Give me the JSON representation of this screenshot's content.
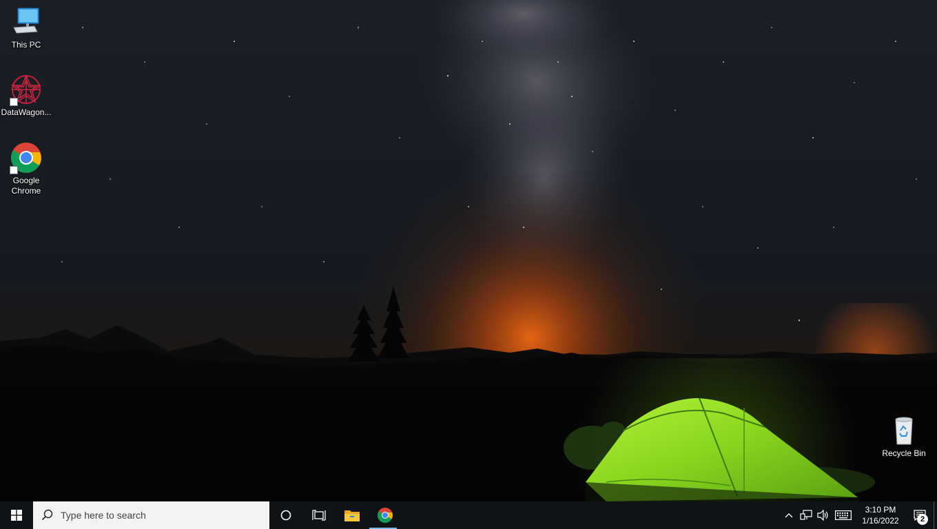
{
  "desktop": {
    "icons": [
      {
        "label": "This PC",
        "icon": "computer-icon"
      },
      {
        "label": "DataWagon...",
        "icon": "datawagon-icon"
      },
      {
        "label": "Google Chrome",
        "icon": "chrome-icon"
      },
      {
        "label": "Recycle Bin",
        "icon": "recycle-bin-icon"
      }
    ]
  },
  "taskbar": {
    "search_placeholder": "Type here to search",
    "apps": [
      {
        "name": "cortana",
        "icon": "cortana-circle-icon"
      },
      {
        "name": "task-view",
        "icon": "task-view-icon"
      },
      {
        "name": "file-explorer",
        "icon": "folder-icon"
      },
      {
        "name": "chrome",
        "icon": "chrome-icon",
        "active": true
      }
    ],
    "tray": {
      "time": "3:10 PM",
      "date": "1/16/2022",
      "notification_count": "2"
    }
  },
  "colors": {
    "taskbar_bg": "#0f1217",
    "search_bg": "#f3f3f3",
    "active_indicator": "#76b9ed",
    "tent_green": "#8fdc2a"
  }
}
